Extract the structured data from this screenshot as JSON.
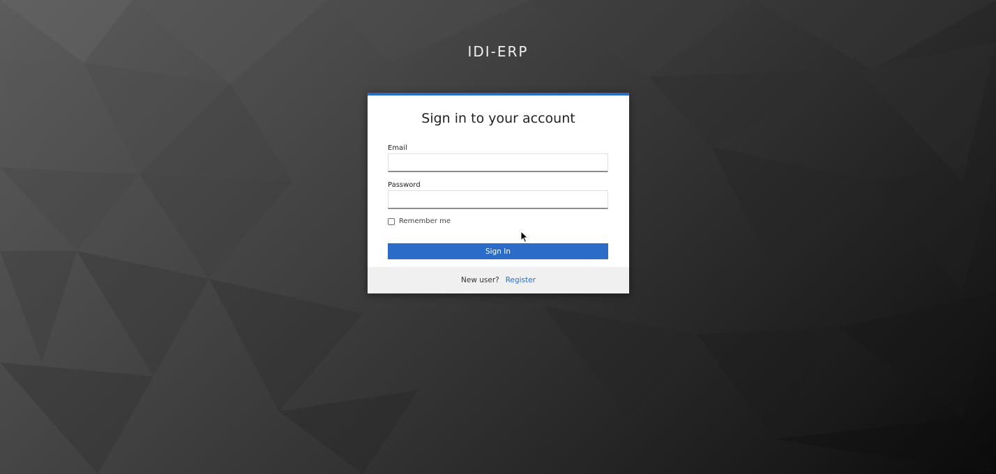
{
  "brand": {
    "title": "IDI-ERP"
  },
  "login": {
    "title": "Sign in to your account",
    "email_label": "Email",
    "email_value": "",
    "password_label": "Password",
    "password_value": "",
    "remember_label": "Remember me",
    "remember_checked": false,
    "signin_label": "Sign In"
  },
  "footer": {
    "new_user_text": "New user?",
    "register_label": "Register"
  },
  "colors": {
    "accent": "#2b6cc8",
    "footer_bg": "#f0f0f0"
  },
  "icons": {
    "cursor": "mouse-pointer-icon"
  }
}
